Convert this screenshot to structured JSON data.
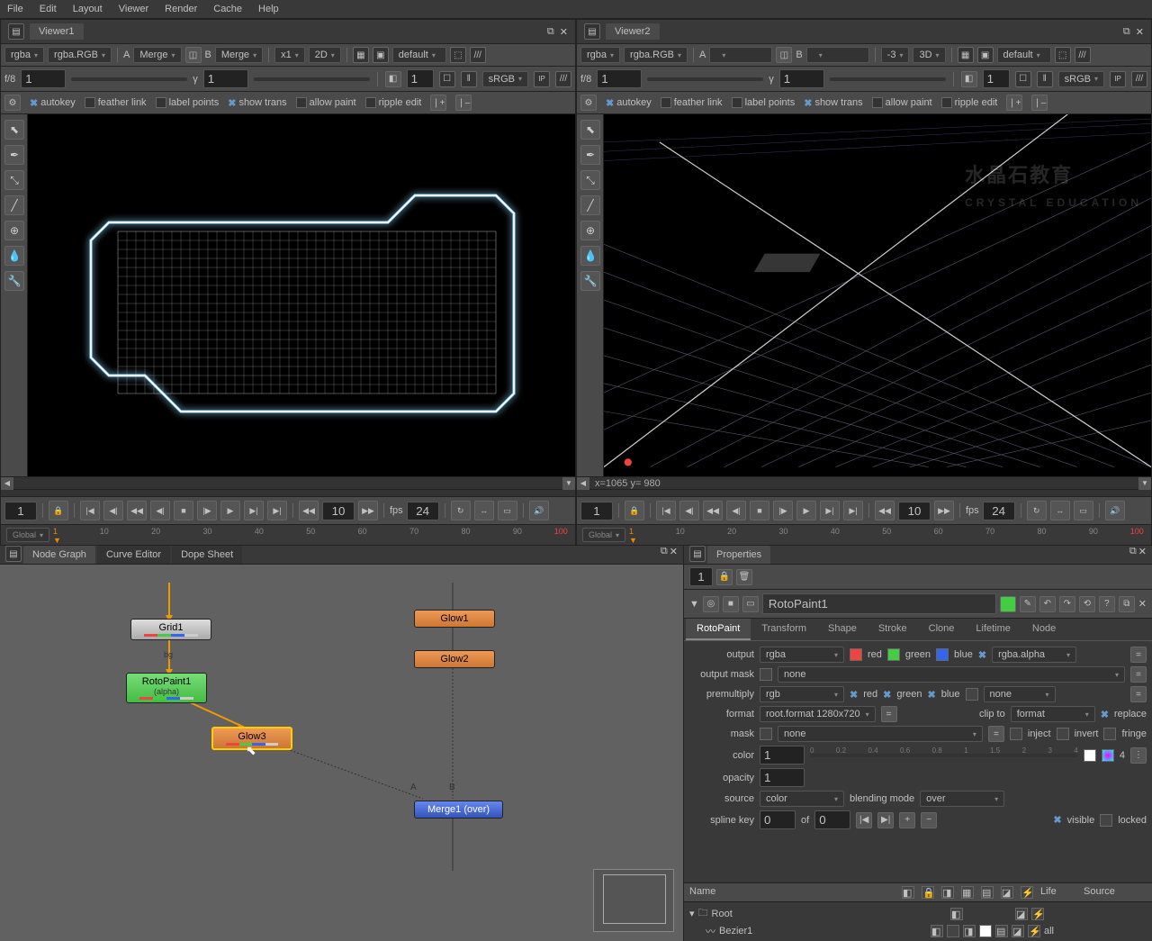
{
  "menubar": [
    "File",
    "Edit",
    "Layout",
    "Viewer",
    "Render",
    "Cache",
    "Help"
  ],
  "viewer1": {
    "title": "Viewer1",
    "channels": "rgba",
    "layer": "rgba.RGB",
    "inputA": "A",
    "mergeA": "Merge",
    "inputB": "B",
    "mergeB": "Merge",
    "zoom": "x1",
    "dim": "2D",
    "viewerProcess": "default",
    "f": "f/8",
    "y": "γ",
    "fval": "1",
    "yval": "1",
    "frame": "1",
    "colorspace": "sRGB",
    "checks": {
      "autokey": "autokey",
      "feather": "feather link",
      "labelpts": "label points",
      "showtrans": "show trans",
      "allowpaint": "allow paint",
      "ripple": "ripple edit"
    }
  },
  "viewer2": {
    "title": "Viewer2",
    "channels": "rgba",
    "layer": "rgba.RGB",
    "inputA": "A",
    "inputB": "B",
    "zoom": "-3",
    "dim": "3D",
    "viewerProcess": "default",
    "f": "f/8",
    "y": "γ",
    "fval": "1",
    "yval": "1",
    "frame": "1",
    "colorspace": "sRGB",
    "coord": "x=1065 y= 980"
  },
  "playback": {
    "frame": "1",
    "skip": "10",
    "fpsLabel": "fps",
    "fps": "24",
    "mode": "Global"
  },
  "ruler": [
    "10",
    "20",
    "30",
    "40",
    "50",
    "60",
    "70",
    "80",
    "90",
    "100"
  ],
  "nodeGraph": {
    "tabs": [
      "Node Graph",
      "Curve Editor",
      "Dope Sheet"
    ],
    "nodes": {
      "grid1": "Grid1",
      "rotopaint1": "RotoPaint1",
      "rotopaint1sub": "(alpha)",
      "glow1": "Glow1",
      "glow2": "Glow2",
      "glow3": "Glow3",
      "merge1": "Merge1 (over)",
      "portA": "A",
      "portB": "B",
      "portBG": "bg"
    }
  },
  "properties": {
    "title": "Properties",
    "count": "1",
    "nodeName": "RotoPaint1",
    "tabs": [
      "RotoPaint",
      "Transform",
      "Shape",
      "Stroke",
      "Clone",
      "Lifetime",
      "Node"
    ],
    "output": {
      "label": "output",
      "value": "rgba",
      "red": "red",
      "green": "green",
      "blue": "blue",
      "alpha": "rgba.alpha"
    },
    "outputMask": {
      "label": "output mask",
      "value": "none"
    },
    "premultiply": {
      "label": "premultiply",
      "value": "rgb",
      "red": "red",
      "green": "green",
      "blue": "blue",
      "alpha": "none"
    },
    "format": {
      "label": "format",
      "value": "root.format 1280x720",
      "clipLabel": "clip to",
      "clip": "format",
      "replace": "replace"
    },
    "mask": {
      "label": "mask",
      "value": "none",
      "inject": "inject",
      "invert": "invert",
      "fringe": "fringe"
    },
    "color": {
      "label": "color",
      "value": "1",
      "n": "4"
    },
    "opacity": {
      "label": "opacity",
      "value": "1"
    },
    "source": {
      "label": "source",
      "value": "color",
      "blendLabel": "blending mode",
      "blend": "over"
    },
    "splineKey": {
      "label": "spline key",
      "v1": "0",
      "of": "of",
      "v2": "0"
    },
    "visible": "visible",
    "locked": "locked",
    "tree": {
      "cols": {
        "name": "Name",
        "life": "Life",
        "source": "Source"
      },
      "root": "Root",
      "bezier": "Bezier1",
      "all": "all"
    }
  }
}
